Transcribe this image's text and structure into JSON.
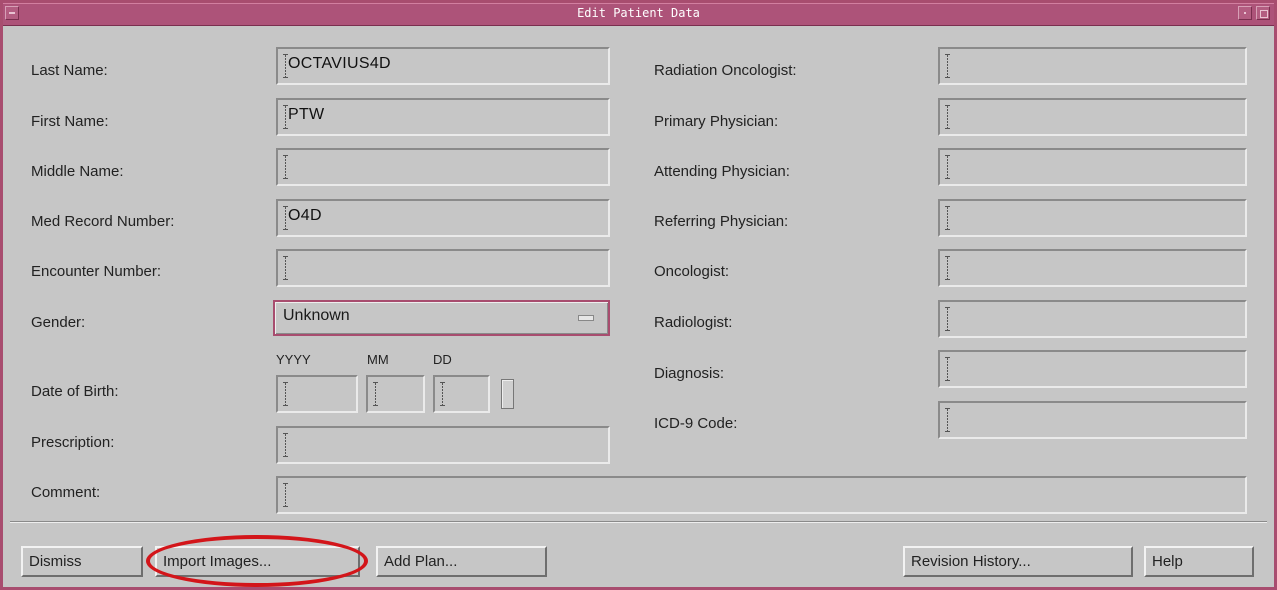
{
  "window": {
    "title": "Edit Patient Data"
  },
  "left_fields": [
    {
      "label": "Last Name:",
      "value": "OCTAVIUS4D"
    },
    {
      "label": "First Name:",
      "value": "PTW"
    },
    {
      "label": "Middle Name:",
      "value": ""
    },
    {
      "label": "Med Record Number:",
      "value": "O4D"
    },
    {
      "label": "Encounter Number:",
      "value": ""
    }
  ],
  "gender": {
    "label": "Gender:",
    "value": "Unknown"
  },
  "dob": {
    "label": "Date of Birth:",
    "yyyy_label": "YYYY",
    "mm_label": "MM",
    "dd_label": "DD",
    "yyyy": "",
    "mm": "",
    "dd": ""
  },
  "prescription": {
    "label": "Prescription:",
    "value": ""
  },
  "comment": {
    "label": "Comment:",
    "value": ""
  },
  "right_fields": [
    {
      "label": "Radiation Oncologist:",
      "value": ""
    },
    {
      "label": "Primary Physician:",
      "value": ""
    },
    {
      "label": "Attending Physician:",
      "value": ""
    },
    {
      "label": "Referring Physician:",
      "value": ""
    },
    {
      "label": "Oncologist:",
      "value": ""
    },
    {
      "label": "Radiologist:",
      "value": ""
    },
    {
      "label": "Diagnosis:",
      "value": ""
    },
    {
      "label": "ICD-9 Code:",
      "value": ""
    }
  ],
  "buttons": {
    "dismiss": "Dismiss",
    "import_images": "Import Images...",
    "add_plan": "Add Plan...",
    "revision_history": "Revision History...",
    "help": "Help"
  },
  "colors": {
    "title_bar": "#ad5379",
    "highlight": "#d3151a",
    "background": "#c6c6c6"
  },
  "icons": [
    "window-menu-icon",
    "minimize-icon",
    "maximize-icon",
    "dropdown-indicator-icon",
    "text-cursor-icon"
  ]
}
